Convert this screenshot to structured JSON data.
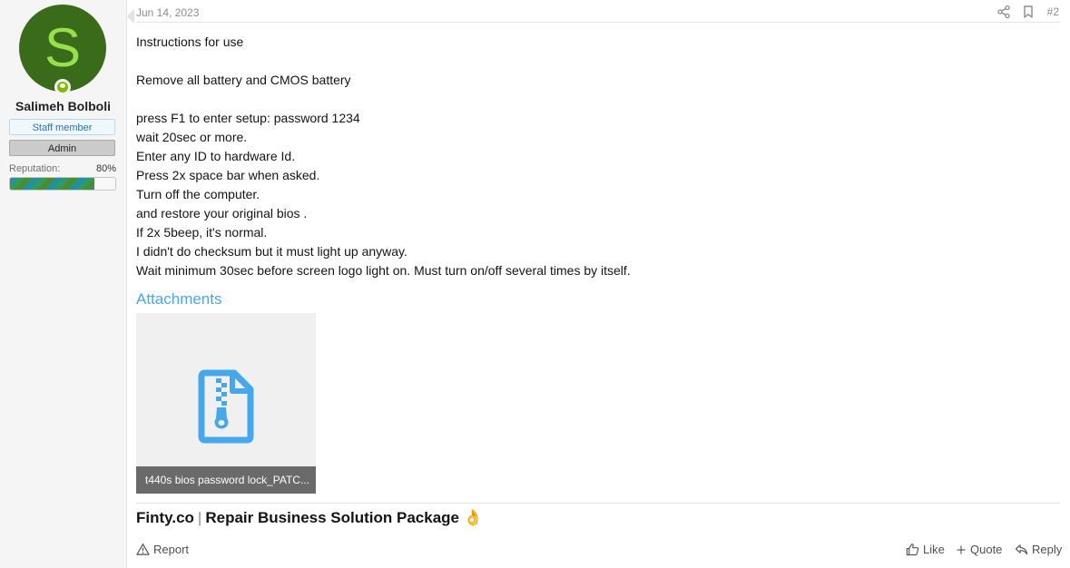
{
  "user": {
    "avatar_letter": "S",
    "name": "Salimeh Bolboli",
    "badges": [
      "Staff member",
      "Admin"
    ],
    "reputation_label": "Reputation:",
    "reputation_value": "80%",
    "reputation_fraction": 0.8,
    "online": true,
    "avatar_color": "#3a6b1b",
    "avatar_letter_color": "#96e04b"
  },
  "post": {
    "date": "Jun 14, 2023",
    "number": "#2",
    "header_icons": [
      "share-icon",
      "bookmark-icon"
    ],
    "lines": [
      "Instructions for use",
      "",
      "Remove all battery and CMOS battery",
      "",
      "press F1 to enter setup: password 1234",
      "wait 20sec or more.",
      "Enter any ID to hardware Id.",
      "Press 2x space bar when asked.",
      "Turn off the computer.",
      "and restore your original bios .",
      "If 2x 5beep, it's normal.",
      "I didn't do checksum but it must light up anyway.",
      "Wait minimum 30sec before screen logo light on. Must turn on/off several times by itself."
    ],
    "attachments_title": "Attachments",
    "attachment": {
      "name": "t440s bios password lock_PATC...",
      "icon": "zip-file-icon"
    },
    "signature": {
      "brand": "Finty.co",
      "separator": "|",
      "text": "Repair Business Solution Package",
      "emoji": "👌"
    }
  },
  "actions": {
    "report": "Report",
    "like": "Like",
    "quote": "Quote",
    "reply": "Reply"
  },
  "colors": {
    "link": "#47a7eb",
    "online": "#7fb900"
  }
}
